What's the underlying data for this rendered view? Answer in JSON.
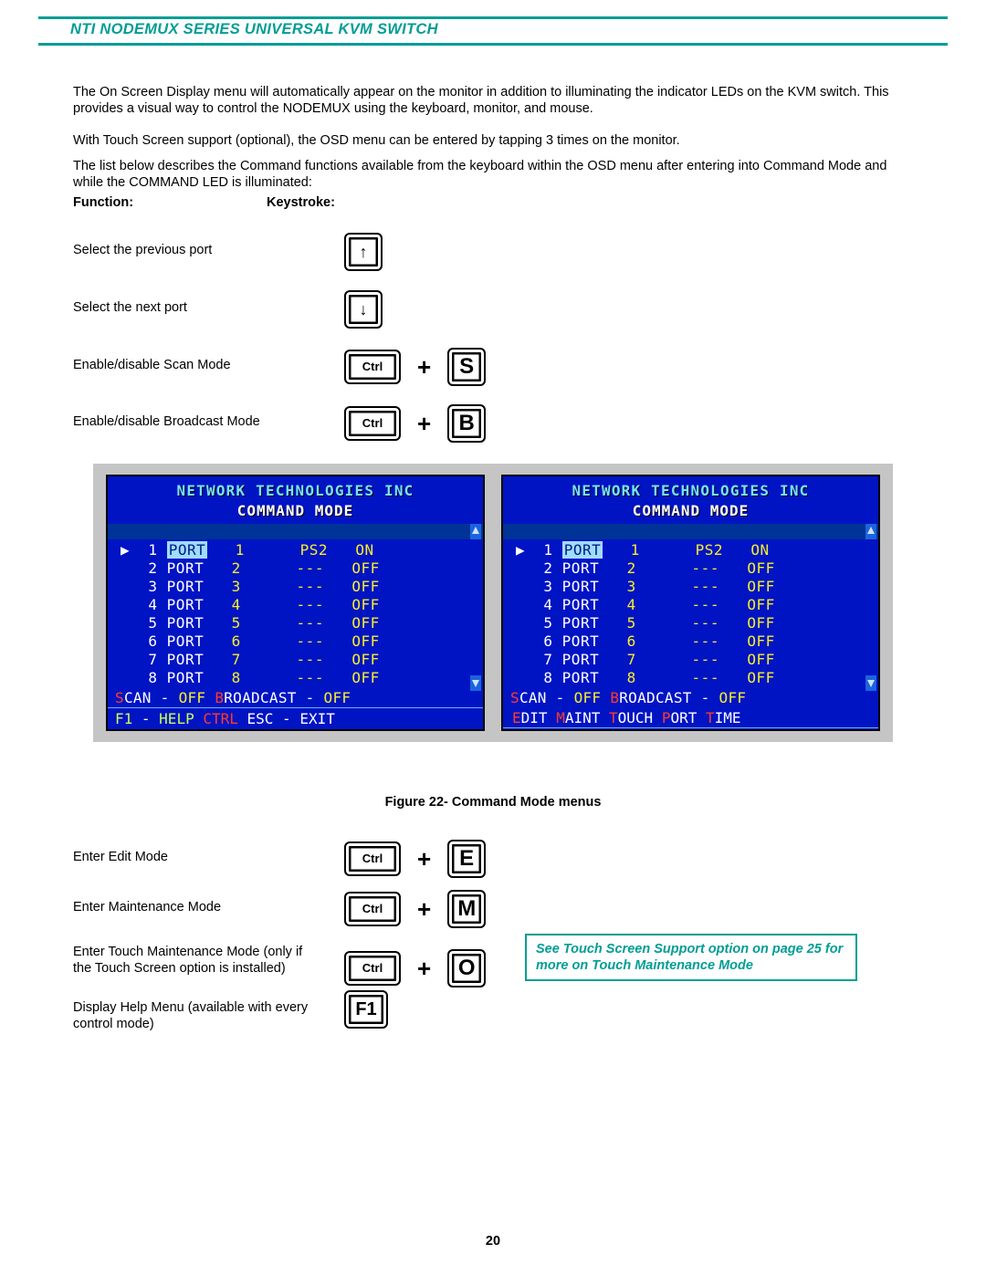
{
  "header": {
    "title": "NTI NODEMUX SERIES UNIVERSAL KVM SWITCH"
  },
  "paragraphs": {
    "p1": "The On Screen Display menu will automatically appear on the monitor in addition to illuminating the indicator LEDs on the KVM switch.  This provides a visual way to control the NODEMUX using the keyboard, monitor,  and mouse.",
    "p2": "With Touch Screen support (optional),  the OSD menu can be entered by tapping 3 times on the monitor.",
    "p3": "The list below describes the Command functions available from the keyboard within the OSD menu after entering into Command Mode and while the COMMAND LED is illuminated:"
  },
  "table_headers": {
    "func": "Function:",
    "key": "Keystroke:"
  },
  "functions_upper": [
    {
      "label": "Select the previous port",
      "keys": [
        {
          "kind": "arrow-up"
        }
      ]
    },
    {
      "label": "Select the next port",
      "keys": [
        {
          "kind": "arrow-down"
        }
      ]
    },
    {
      "label": "Enable/disable Scan Mode",
      "keys": [
        {
          "kind": "ctrl",
          "text": "Ctrl"
        },
        {
          "kind": "plus",
          "text": "+"
        },
        {
          "kind": "letter",
          "text": "S"
        }
      ]
    },
    {
      "label": "Enable/disable Broadcast Mode",
      "keys": [
        {
          "kind": "ctrl",
          "text": "Ctrl"
        },
        {
          "kind": "plus",
          "text": "+"
        },
        {
          "kind": "letter",
          "text": "B"
        }
      ]
    }
  ],
  "figure_caption": "Figure 22- Command Mode menus",
  "functions_lower": [
    {
      "label": "Enter Edit Mode",
      "keys": [
        {
          "kind": "ctrl",
          "text": "Ctrl"
        },
        {
          "kind": "plus",
          "text": "+"
        },
        {
          "kind": "letter",
          "text": "E"
        }
      ]
    },
    {
      "label": "Enter Maintenance Mode",
      "keys": [
        {
          "kind": "ctrl",
          "text": "Ctrl"
        },
        {
          "kind": "plus",
          "text": "+"
        },
        {
          "kind": "letter",
          "text": "M"
        }
      ]
    },
    {
      "label": "Enter Touch Maintenance Mode (only if the Touch Screen option is installed)",
      "keys": [
        {
          "kind": "ctrl",
          "text": "Ctrl"
        },
        {
          "kind": "plus",
          "text": "+"
        },
        {
          "kind": "letter",
          "text": "O"
        }
      ]
    },
    {
      "label": "Display Help Menu (available with every control mode)",
      "keys": [
        {
          "kind": "f1",
          "text": "F1"
        }
      ]
    }
  ],
  "note_box": "See Touch Screen Support option on page 25 for more on Touch Maintenance Mode",
  "osd": {
    "title": "NETWORK  TECHNOLOGIES  INC",
    "subtitle": "COMMAND  MODE",
    "ports": [
      {
        "num": "1",
        "name": "PORT",
        "val": "1",
        "type": "PS2",
        "state": "ON",
        "selected": true
      },
      {
        "num": "2",
        "name": "PORT",
        "val": "2",
        "type": "---",
        "state": "OFF"
      },
      {
        "num": "3",
        "name": "PORT",
        "val": "3",
        "type": "---",
        "state": "OFF"
      },
      {
        "num": "4",
        "name": "PORT",
        "val": "4",
        "type": "---",
        "state": "OFF"
      },
      {
        "num": "5",
        "name": "PORT",
        "val": "5",
        "type": "---",
        "state": "OFF"
      },
      {
        "num": "6",
        "name": "PORT",
        "val": "6",
        "type": "---",
        "state": "OFF"
      },
      {
        "num": "7",
        "name": "PORT",
        "val": "7",
        "type": "---",
        "state": "OFF"
      },
      {
        "num": "8",
        "name": "PORT",
        "val": "8",
        "type": "---",
        "state": "OFF"
      }
    ],
    "scan": {
      "s": "S",
      "can": "CAN",
      "dash": " - ",
      "off": "OFF",
      "sp": "   ",
      "b": "B",
      "roadcast": "ROADCAST",
      "dash2": " - ",
      "off2": "OFF"
    },
    "menus": {
      "e": "E",
      "dit": "DIT",
      "sp": "  ",
      "m": "M",
      "aint": "AINT",
      "sp2": "  ",
      "t": "T",
      "ouch": "OUCH",
      "sp3": "  ",
      "p": "P",
      "ort": "ORT",
      "sp4": "  ",
      "t2": "T",
      "ime": "IME"
    },
    "footer": {
      "f1": "F1",
      "dash": " - ",
      "help": "HELP",
      "sp": "   ",
      "ctrl": "CTRL",
      "sp2": "     ",
      "esc": "ESC",
      "dash2": " - ",
      "exit": "EXIT"
    }
  },
  "page_number": "20"
}
